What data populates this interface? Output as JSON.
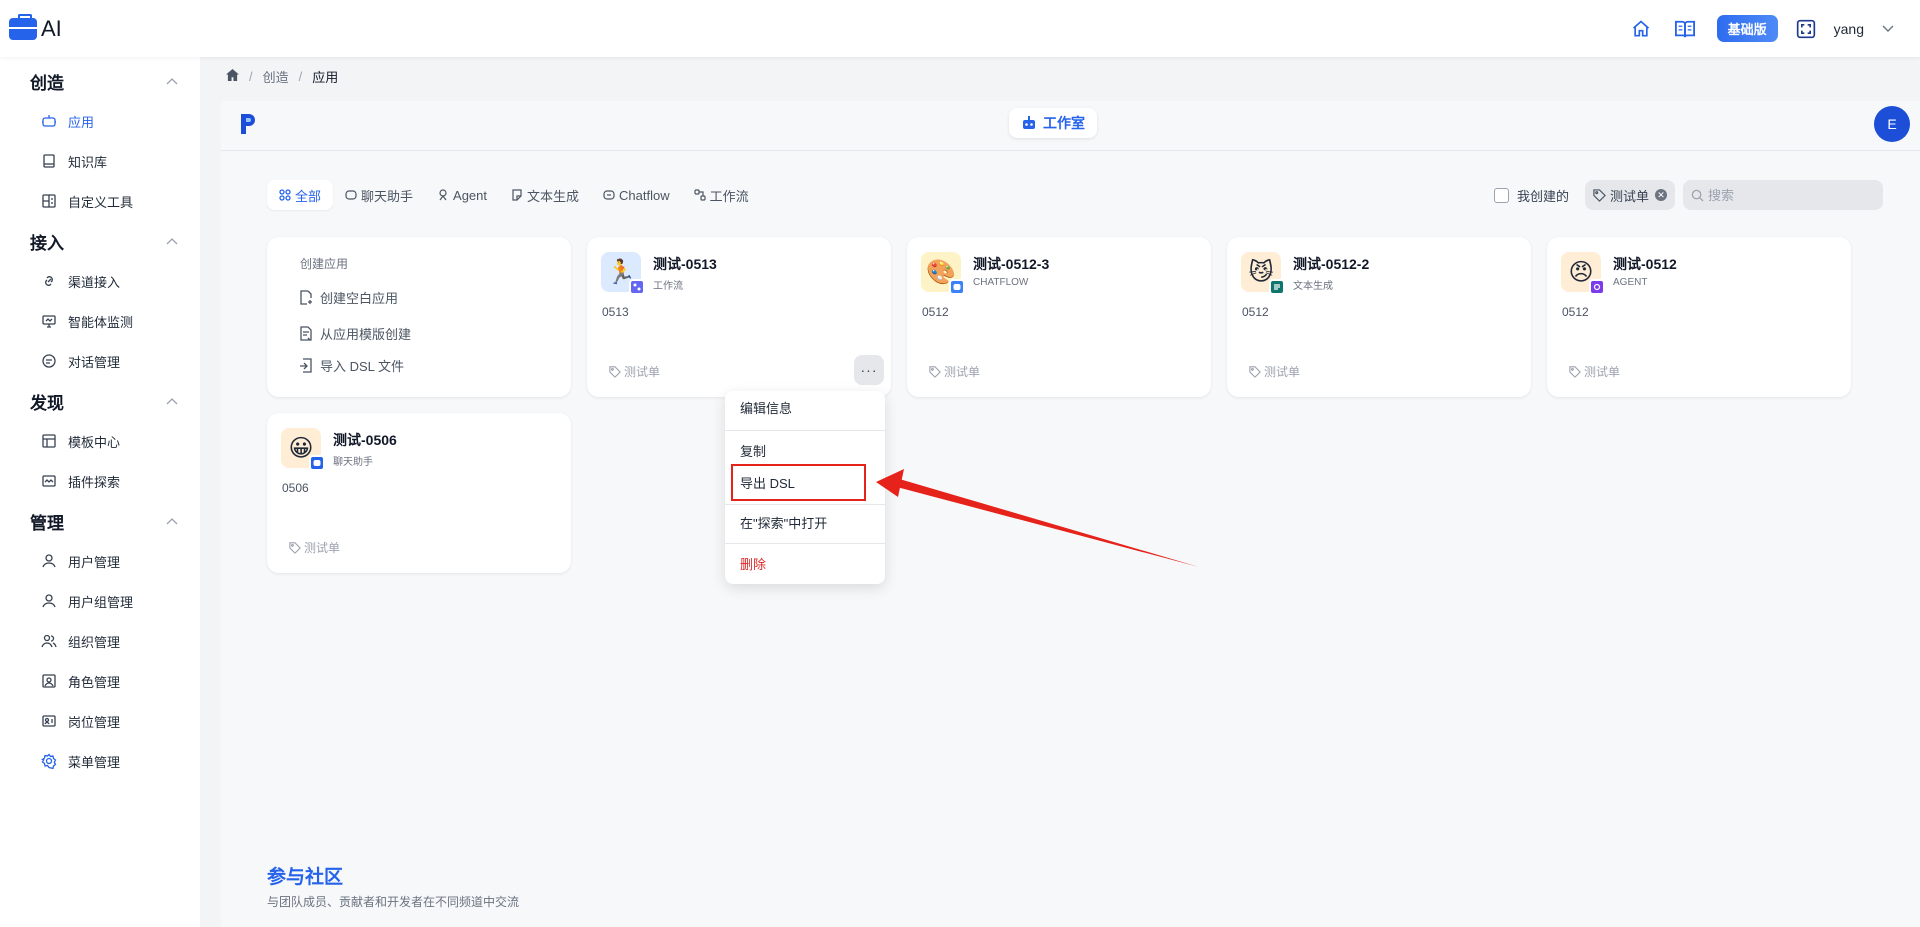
{
  "header": {
    "brand_text": "AI",
    "plan_badge": "基础版",
    "username": "yang"
  },
  "sidebar": {
    "sections": [
      {
        "title": "创造",
        "items": [
          {
            "label": "应用",
            "icon": "robot-icon",
            "active": true
          },
          {
            "label": "知识库",
            "icon": "book-icon"
          },
          {
            "label": "自定义工具",
            "icon": "tool-icon"
          }
        ]
      },
      {
        "title": "接入",
        "items": [
          {
            "label": "渠道接入",
            "icon": "link-icon"
          },
          {
            "label": "智能体监测",
            "icon": "monitor-icon"
          },
          {
            "label": "对话管理",
            "icon": "chat-icon"
          }
        ]
      },
      {
        "title": "发现",
        "items": [
          {
            "label": "模板中心",
            "icon": "template-icon"
          },
          {
            "label": "插件探索",
            "icon": "plugin-icon"
          }
        ]
      },
      {
        "title": "管理",
        "items": [
          {
            "label": "用户管理",
            "icon": "user-icon"
          },
          {
            "label": "用户组管理",
            "icon": "user-group-icon"
          },
          {
            "label": "组织管理",
            "icon": "org-icon"
          },
          {
            "label": "角色管理",
            "icon": "role-icon"
          },
          {
            "label": "岗位管理",
            "icon": "post-icon"
          },
          {
            "label": "菜单管理",
            "icon": "menu-settings-icon"
          }
        ]
      }
    ]
  },
  "breadcrumb": {
    "items": [
      "创造",
      "应用"
    ]
  },
  "panel": {
    "studio_label": "工作室",
    "avatar_letter": "E"
  },
  "filters": {
    "tabs": [
      "全部",
      "聊天助手",
      "Agent",
      "文本生成",
      "Chatflow",
      "工作流"
    ],
    "mine_label": "我创建的",
    "tag_label": "测试单",
    "search_placeholder": "搜索"
  },
  "create_card": {
    "title": "创建应用",
    "items": [
      "创建空白应用",
      "从应用模版创建",
      "导入 DSL 文件"
    ]
  },
  "apps": [
    {
      "name": "测试-0513",
      "type": "工作流",
      "desc": "0513",
      "tag": "测试单",
      "emoji": "🏃",
      "bg": "#dbeafe",
      "badge_color": "#6366f1"
    },
    {
      "name": "测试-0512-3",
      "type": "CHATFLOW",
      "desc": "0512",
      "tag": "测试单",
      "emoji": "🎨",
      "bg": "#fef3c7",
      "badge_color": "#3b82f6"
    },
    {
      "name": "测试-0512-2",
      "type": "文本生成",
      "desc": "0512",
      "tag": "测试单",
      "emoji": "😼",
      "bg": "#ffedd5",
      "badge_color": "#0f766e"
    },
    {
      "name": "测试-0512",
      "type": "AGENT",
      "desc": "0512",
      "tag": "测试单",
      "emoji": "😠",
      "bg": "#ffedd5",
      "badge_color": "#7c3aed"
    },
    {
      "name": "测试-0506",
      "type": "聊天助手",
      "desc": "0506",
      "tag": "测试单",
      "emoji": "😀",
      "bg": "#ffedd5",
      "badge_color": "#2563eb"
    }
  ],
  "context_menu": {
    "edit": "编辑信息",
    "copy": "复制",
    "export": "导出 DSL",
    "open_explore": "在\"探索\"中打开",
    "delete": "删除"
  },
  "community": {
    "title": "参与社区",
    "desc": "与团队成员、贡献者和开发者在不同频道中交流"
  },
  "colors": {
    "accent": "#2563eb",
    "danger": "#dc2626",
    "annotation": "#e5231b"
  }
}
